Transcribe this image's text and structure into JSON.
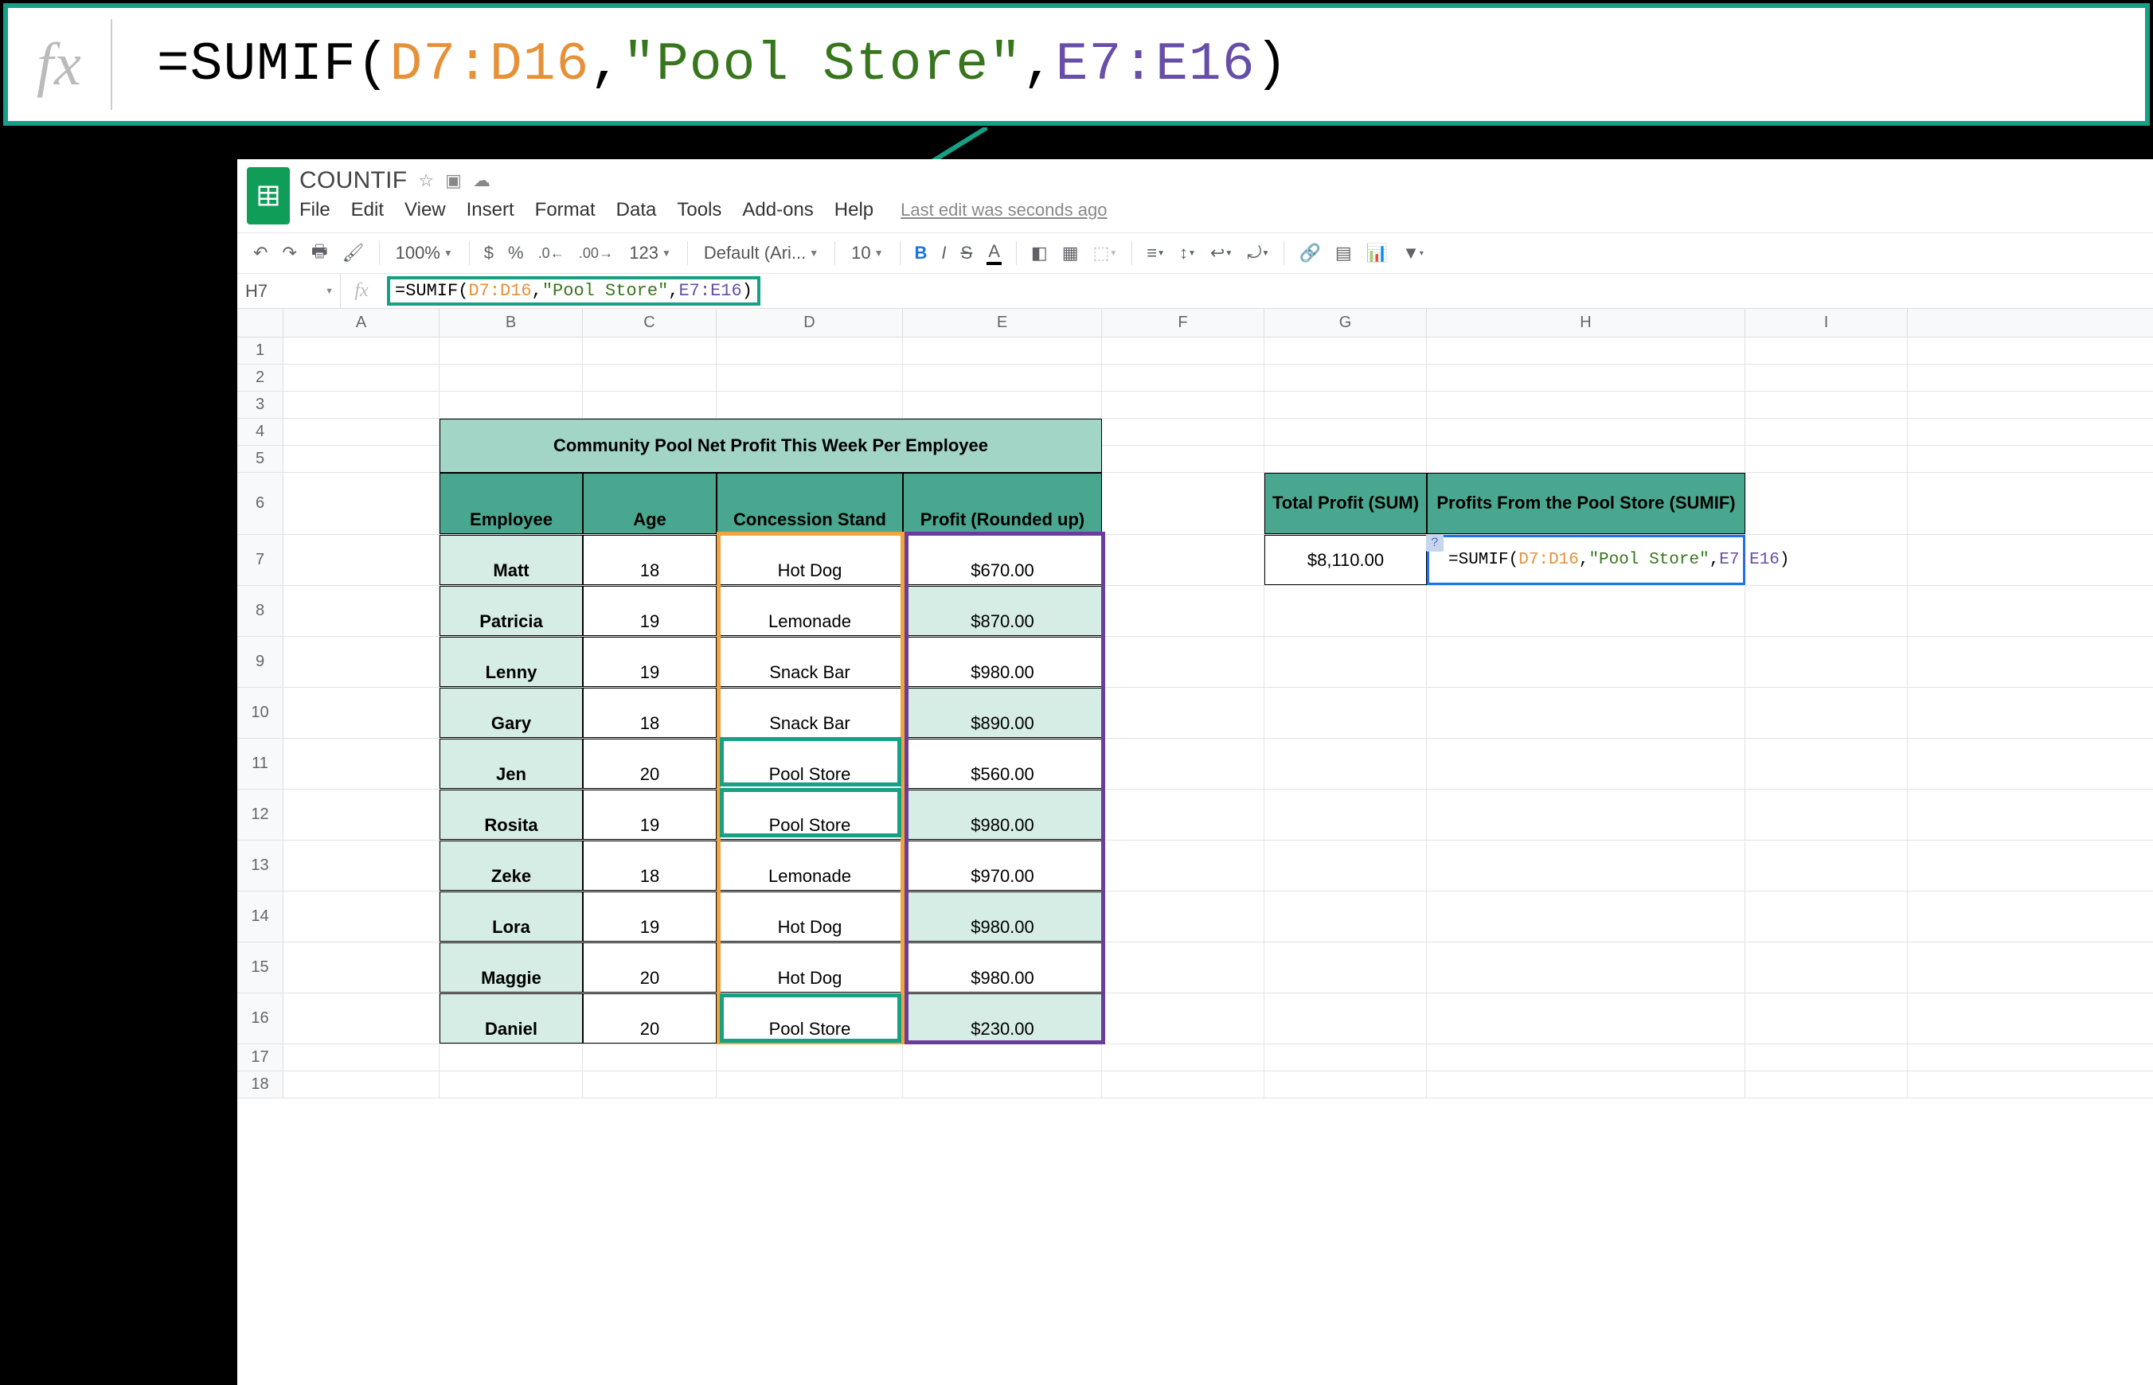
{
  "callout": {
    "prefix": "=SUMIF(",
    "range1": "D7:D16",
    "comma1": ",",
    "criterion": "\"Pool Store\"",
    "comma2": ",",
    "range2": "E7:E16",
    "suffix": ")"
  },
  "doc": {
    "title": "COUNTIF",
    "menus": [
      "File",
      "Edit",
      "View",
      "Insert",
      "Format",
      "Data",
      "Tools",
      "Add-ons",
      "Help"
    ],
    "last_edit": "Last edit was seconds ago"
  },
  "toolbar": {
    "zoom": "100%",
    "currency": "$",
    "percent": "%",
    "dec_dec": ".0←",
    "inc_dec": ".00",
    "num_fmt": "123",
    "font": "Default (Ari...",
    "font_size": "10"
  },
  "namebox": "H7",
  "fbar": {
    "prefix": "=SUMIF(",
    "range1": "D7:D16",
    "comma1": ",",
    "criterion": "\"Pool Store\"",
    "comma2": ",",
    "range2": "E7:E16",
    "suffix": ")"
  },
  "cols": [
    "A",
    "B",
    "C",
    "D",
    "E",
    "F",
    "G",
    "H",
    "I"
  ],
  "row_numbers": [
    1,
    2,
    3,
    4,
    5,
    6,
    7,
    8,
    9,
    10,
    11,
    12,
    13,
    14,
    15,
    16,
    17,
    18
  ],
  "table": {
    "title": "Community Pool Net Profit This Week Per Employee",
    "headers": [
      "Employee",
      "Age",
      "Concession Stand",
      "Profit (Rounded up)"
    ],
    "rows": [
      {
        "emp": "Matt",
        "age": "18",
        "stand": "Hot Dog",
        "profit": "$670.00"
      },
      {
        "emp": "Patricia",
        "age": "19",
        "stand": "Lemonade",
        "profit": "$870.00"
      },
      {
        "emp": "Lenny",
        "age": "19",
        "stand": "Snack Bar",
        "profit": "$980.00"
      },
      {
        "emp": "Gary",
        "age": "18",
        "stand": "Snack Bar",
        "profit": "$890.00"
      },
      {
        "emp": "Jen",
        "age": "20",
        "stand": "Pool Store",
        "profit": "$560.00"
      },
      {
        "emp": "Rosita",
        "age": "19",
        "stand": "Pool Store",
        "profit": "$980.00"
      },
      {
        "emp": "Zeke",
        "age": "18",
        "stand": "Lemonade",
        "profit": "$970.00"
      },
      {
        "emp": "Lora",
        "age": "19",
        "stand": "Hot Dog",
        "profit": "$980.00"
      },
      {
        "emp": "Maggie",
        "age": "20",
        "stand": "Hot Dog",
        "profit": "$980.00"
      },
      {
        "emp": "Daniel",
        "age": "20",
        "stand": "Pool Store",
        "profit": "$230.00"
      }
    ]
  },
  "summary": {
    "head1": "Total Profit (SUM)",
    "head2": "Profits From the Pool Store (SUMIF)",
    "total": "$8,110.00"
  },
  "edit_cell": {
    "prefix": "=SUMIF(",
    "range1": "D7:D16",
    "comma1": ",",
    "criterion": "\"Pool Store\"",
    "comma2": ",",
    "range2": "E7:E16",
    "suffix": ")",
    "hint": "?"
  }
}
